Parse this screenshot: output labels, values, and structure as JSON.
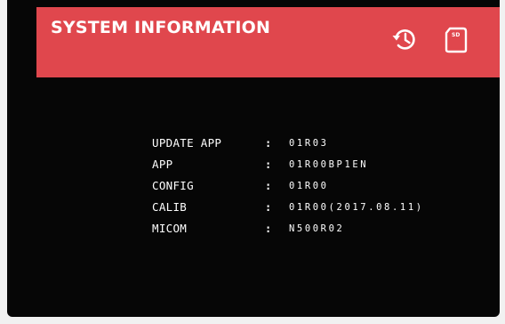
{
  "header": {
    "title": "SYSTEM INFORMATION",
    "background_color": "#e0474d",
    "icons": [
      "history-icon",
      "sd-card-icon"
    ],
    "sd_icon_text": "SD"
  },
  "info": {
    "separator": ":",
    "rows": [
      {
        "label": "UPDATE APP",
        "value": "01R03"
      },
      {
        "label": "APP",
        "value": "01R00BP1EN"
      },
      {
        "label": "CONFIG",
        "value": "01R00"
      },
      {
        "label": "CALIB",
        "value": "01R00(2017.08.11)"
      },
      {
        "label": "MICOM",
        "value": "N500R02"
      }
    ]
  }
}
